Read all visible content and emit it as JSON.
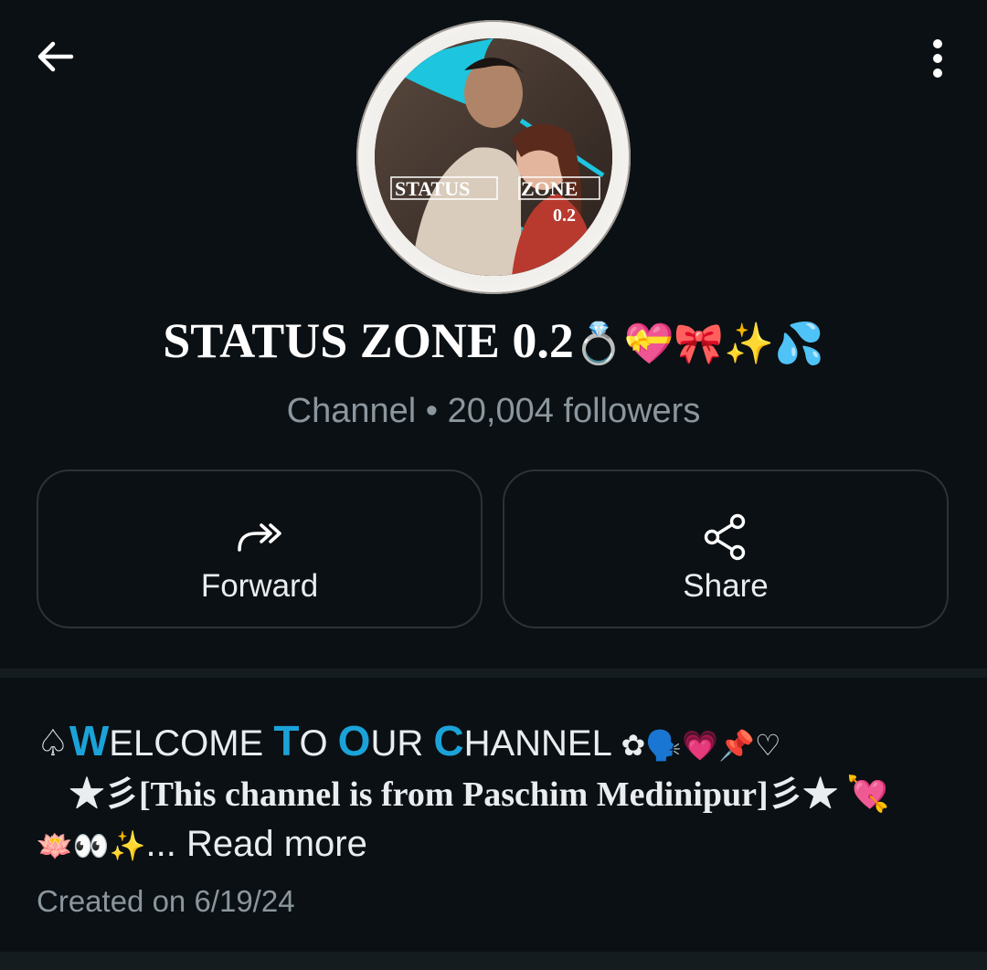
{
  "header": {
    "back_icon": "arrow-left-icon",
    "menu_icon": "more-vertical-icon"
  },
  "avatar": {
    "logo_text": "STATUS ZONE 0.2",
    "accent_color": "#1ec5de"
  },
  "channel": {
    "name": "STATUS ZONE 0.2",
    "name_emojis": "💍💝🎀✨💦",
    "meta": "Channel • 20,004 followers"
  },
  "actions": [
    {
      "label": "Forward",
      "icon": "forward-icon"
    },
    {
      "label": "Share",
      "icon": "share-icon"
    }
  ],
  "description": {
    "line1_prefix": "♤",
    "w1_cap": "W",
    "w1_rest": "ELCOME ",
    "w2_cap": "T",
    "w2_rest": "O ",
    "w3_cap": "O",
    "w3_rest": "UR ",
    "w4_cap": "C",
    "w4_rest": "HANNEL ",
    "line1_emojis": "✿🗣️💗📌♡",
    "line2": "★彡[This channel is from Paschim Medinipur]彡★ 💘",
    "line3_emojis": "🪷👀✨",
    "read_more": "... Read more",
    "created": "Created on 6/19/24"
  },
  "colors": {
    "background": "#0b1014",
    "text_primary": "#e9edef",
    "text_secondary": "#8b969d",
    "accent_blue": "#1ba3d9"
  }
}
